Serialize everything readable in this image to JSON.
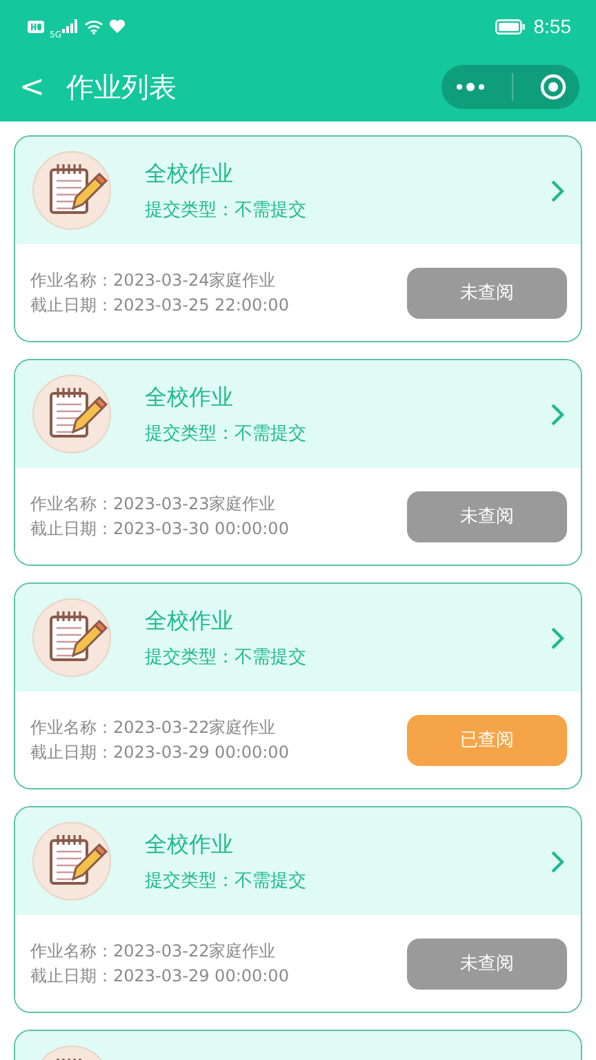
{
  "status_bar": {
    "network": "5G",
    "time": "8:55"
  },
  "nav": {
    "back": "<",
    "title": "作业列表"
  },
  "homeworks": [
    {
      "kind": "full",
      "title": "全校作业",
      "submit_type": "提交类型：不需提交",
      "name": "作业名称：2023-03-24家庭作业",
      "deadline": "截止日期：2023-03-25 22:00:00",
      "status": "未查阅",
      "checked": false
    },
    {
      "kind": "full",
      "title": "全校作业",
      "submit_type": "提交类型：不需提交",
      "name": "作业名称：2023-03-23家庭作业",
      "deadline": "截止日期：2023-03-30 00:00:00",
      "status": "未查阅",
      "checked": false
    },
    {
      "kind": "full",
      "title": "全校作业",
      "submit_type": "提交类型：不需提交",
      "name": "作业名称：2023-03-22家庭作业",
      "deadline": "截止日期：2023-03-29 00:00:00",
      "status": "已查阅",
      "checked": true
    },
    {
      "kind": "full",
      "title": "全校作业",
      "submit_type": "提交类型：不需提交",
      "name": "作业名称：2023-03-22家庭作业",
      "deadline": "截止日期：2023-03-29 00:00:00",
      "status": "未查阅",
      "checked": false
    },
    {
      "kind": "partial"
    }
  ]
}
